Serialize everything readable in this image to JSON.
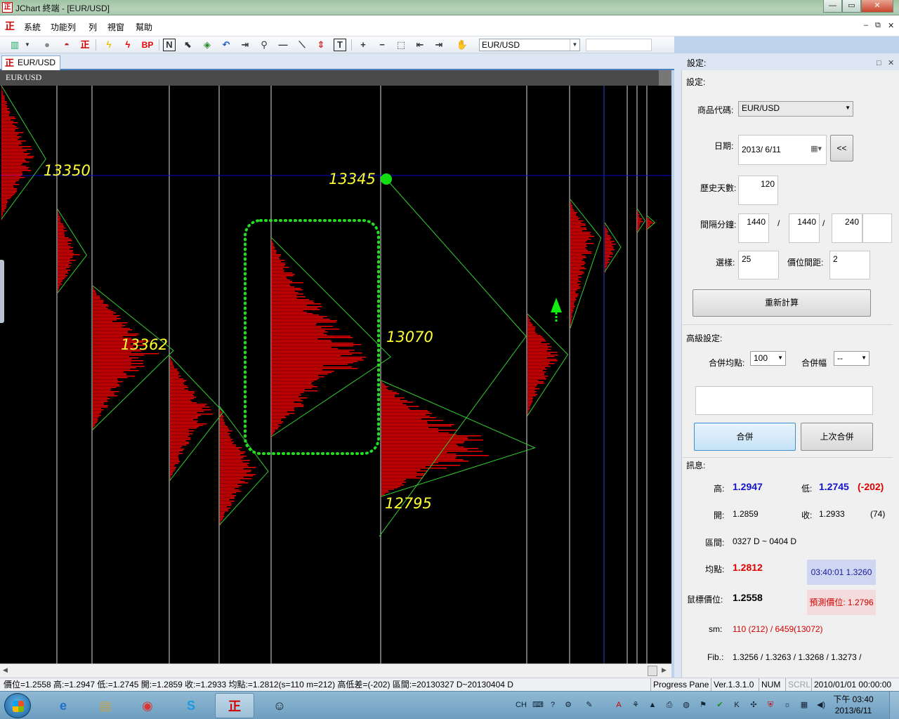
{
  "window": {
    "title": "JChart 終端 - [EUR/USD]",
    "buttons": {
      "minimize": "—",
      "maximize": "▭",
      "close": "✕"
    }
  },
  "menu": {
    "logo": "正",
    "items": [
      "系統",
      "功能列",
      "列",
      "視窗",
      "幫助"
    ],
    "mdi_buttons": [
      "–",
      "⧉",
      "✕"
    ]
  },
  "toolbar": {
    "icons": [
      "chart-bars-icon",
      "gray-circle-icon",
      "red-car-icon",
      "zheng-logo-icon",
      "yellow-lightning-icon",
      "red-lightning-icon",
      "bp-icon",
      "n-icon",
      "cursor-icon",
      "cube-icon",
      "undo-icon",
      "arrow-right-icon",
      "magnifier-icon",
      "horizontal-line-icon",
      "diagonal-line-icon",
      "up-down-arrows-icon",
      "t-tool-icon",
      "plus-icon",
      "minus-icon",
      "select-box-icon",
      "arrow-back-icon",
      "arrow-forward-icon",
      "hand-icon"
    ],
    "bp_label": "BP",
    "n_label": "N",
    "t_label": "T",
    "symbol": "EUR/USD"
  },
  "document": {
    "tab_label": "EUR/USD",
    "chart_header": "EUR/USD"
  },
  "chart": {
    "labels": [
      {
        "text": "13350"
      },
      {
        "text": "13345"
      },
      {
        "text": "13362"
      },
      {
        "text": "13070"
      },
      {
        "text": "12795"
      }
    ],
    "colors": {
      "background": "#000000",
      "profile": "#ff0000",
      "line": "#33cc33",
      "label": "#ffff33",
      "marker": "#00dd00",
      "hline": "#0000cc"
    }
  },
  "settings": {
    "panel_title": "設定:",
    "section_title": "設定:",
    "product_code_label": "商品代碼:",
    "product_code": "EUR/USD",
    "date_label": "日期:",
    "date_value": "2013/  6/11",
    "back_button": "<<",
    "history_days_label": "歷史天數:",
    "history_days": "120",
    "interval_label": "間隔分鐘:",
    "interval_1": "1440",
    "interval_2": "1440",
    "interval_3": "240",
    "slash": "/",
    "choose_label": "選樣:",
    "choose_value": "25",
    "price_gap_label": "價位間距:",
    "price_gap": "2",
    "recalc_button": "重新計算",
    "advanced_title": "高級設定:",
    "merge_avg_label": "合併均點:",
    "merge_avg_value": "100",
    "merge_range_label": "合併幅度:",
    "merge_range_value": "--",
    "merge_button": "合併",
    "last_merge_button": "上次合併",
    "info_title": "訊息:",
    "high_label": "高:",
    "high_value": "1.2947",
    "low_label": "低:",
    "low_value": "1.2745",
    "low_diff": "(-202)",
    "open_label": "開:",
    "open_value": "1.2859",
    "close_label": "收:",
    "close_value": "1.2933",
    "close_extra": "(74)",
    "range_label": "區間:",
    "range_value": "0327 D ~ 0404 D",
    "avg_label": "均點:",
    "avg_value": "1.2812",
    "time_price": "03:40:01  1.3260",
    "cursor_label": "鼠標價位:",
    "cursor_value": "1.2558",
    "predict": "預測價位: 1.2796",
    "sm_label": "sm:",
    "sm_value": "110 (212) / 6459(13072)",
    "fib_label": "Fib.:",
    "fib_value": "1.3256 / 1.3263 / 1.3268 / 1.3273 /"
  },
  "status": {
    "main": "價位=1.2558  高:=1.2947  低:=1.2745  開:=1.2859  收:=1.2933  均點:=1.2812(s=110 m=212)  高低差=(-202)  區間:=20130327 D~20130404 D",
    "progress": "Progress Pane",
    "version": "Ver.1.3.1.0",
    "num": "NUM",
    "scrl": "SCRL",
    "datetime": "2010/01/01 00:00:00"
  },
  "taskbar": {
    "time": "下午 03:40",
    "date": "2013/6/11",
    "lang": "CH",
    "tasks": [
      "ie-icon",
      "explorer-icon",
      "chrome-icon",
      "skype-icon",
      "jchart-icon",
      "qq-icon"
    ]
  }
}
